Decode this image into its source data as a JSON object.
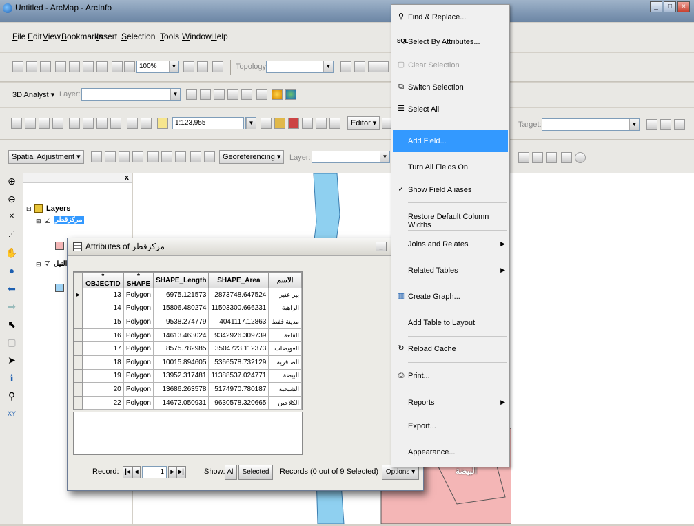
{
  "window": {
    "title": "Untitled - ArcMap - ArcInfo"
  },
  "menu": [
    "File",
    "Edit",
    "View",
    "Bookmarks",
    "Insert",
    "Selection",
    "Tools",
    "Window",
    "Help"
  ],
  "toolbar1": {
    "zoom": "100%",
    "topology_label": "Topology:"
  },
  "toolbar2": {
    "analyst_label": "3D Analyst ▾",
    "layer_label": "Layer:"
  },
  "toolbar3": {
    "scale": "1:123,955",
    "editor_label": "Editor ▾",
    "target_label": "Target:"
  },
  "toolbar4": {
    "spatial_adjustment": "Spatial Adjustment ▾",
    "georeferencing": "Georeferencing ▾",
    "layer_label": "Layer:"
  },
  "toc": {
    "layers_label": "Layers",
    "layer1": "مركزقطر",
    "layer2": "النيل"
  },
  "attributes": {
    "title": "Attributes of مركزقطر",
    "columns": [
      "* OBJECTID",
      "* SHAPE",
      "SHAPE_Length",
      "SHAPE_Area",
      "الاسم"
    ],
    "rows": [
      [
        "13",
        "Polygon",
        "6975.121573",
        "2873748.647524",
        "بير عنبر"
      ],
      [
        "14",
        "Polygon",
        "15806.480274",
        "11503300.666231",
        "الراهبة"
      ],
      [
        "15",
        "Polygon",
        "9538.274779",
        "4041117.12863",
        "مدينة قفط"
      ],
      [
        "16",
        "Polygon",
        "14613.463024",
        "9342926.309739",
        "القلعة"
      ],
      [
        "17",
        "Polygon",
        "8575.782985",
        "3504723.112373",
        "العويضات"
      ],
      [
        "18",
        "Polygon",
        "10015.894605",
        "5366578.732129",
        "الضاقرية"
      ],
      [
        "19",
        "Polygon",
        "13952.317481",
        "11388537.024771",
        "البيضة"
      ],
      [
        "20",
        "Polygon",
        "13686.263578",
        "5174970.780187",
        "الشيخية"
      ],
      [
        "22",
        "Polygon",
        "14672.050931",
        "9630578.320665",
        "الكلاحين"
      ]
    ],
    "record_label": "Record:",
    "record_value": "1",
    "show_label": "Show:",
    "all_label": "All",
    "selected_label": "Selected",
    "records_status": "Records (0 out of 9 Selected)",
    "options_label": "Options ▾"
  },
  "map": {
    "label": "البيضة"
  },
  "context_menu": {
    "items": [
      {
        "label": "Find & Replace...",
        "icon": "binoculars-icon"
      },
      {
        "label": "Select By Attributes...",
        "icon": "sql-icon"
      },
      {
        "label": "Clear Selection",
        "icon": "clear-icon",
        "disabled": true
      },
      {
        "label": "Switch Selection",
        "icon": "switch-icon"
      },
      {
        "label": "Select All",
        "icon": "select-all-icon"
      },
      {
        "label": "Add Field...",
        "highlighted": true
      },
      {
        "label": "Turn All Fields On"
      },
      {
        "label": "Show Field Aliases",
        "checked": true
      },
      {
        "label": "Restore Default Column Widths"
      },
      {
        "label": "Joins and Relates",
        "submenu": true
      },
      {
        "label": "Related Tables",
        "submenu": true
      },
      {
        "label": "Create Graph...",
        "icon": "graph-icon"
      },
      {
        "label": "Add Table to Layout"
      },
      {
        "label": "Reload Cache",
        "icon": "reload-icon"
      },
      {
        "label": "Print...",
        "icon": "print-icon"
      },
      {
        "label": "Reports",
        "submenu": true
      },
      {
        "label": "Export..."
      },
      {
        "label": "Appearance..."
      }
    ]
  },
  "colors": {
    "highlight": "#3399ff",
    "layer1_fill": "#f4b6b6",
    "layer2_fill": "#9fd3f5",
    "river": "#8fd0f0"
  }
}
